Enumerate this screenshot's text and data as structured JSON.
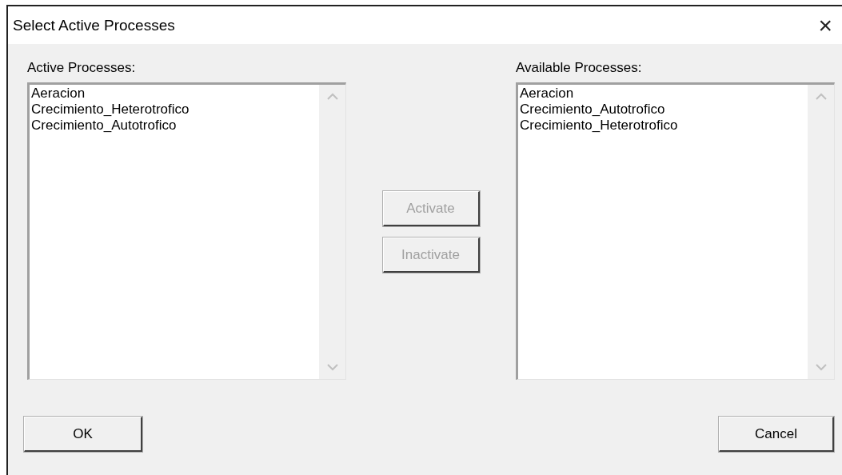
{
  "window": {
    "title": "Select Active Processes",
    "close": "×"
  },
  "active_list": {
    "label": "Active Processes:",
    "items": [
      {
        "text": "Aeracion",
        "selected": false
      },
      {
        "text": "Crecimiento_Heterotrofico",
        "selected": false
      },
      {
        "text": "Crecimiento_Autotrofico",
        "selected": false
      }
    ]
  },
  "middle_buttons": [
    {
      "label": "Activate",
      "disabled": true
    },
    {
      "label": "Inactivate",
      "disabled": true
    }
  ],
  "available_list": {
    "label": "Available Processes:",
    "items": [
      {
        "text": "Aeracion",
        "selected": false
      },
      {
        "text": "Crecimiento_Autotrofico",
        "selected": false
      },
      {
        "text": "Crecimiento_Heterotrofico",
        "selected": false
      }
    ]
  },
  "footer_buttons": [
    {
      "label": "OK"
    },
    {
      "label": "Cancel"
    }
  ]
}
